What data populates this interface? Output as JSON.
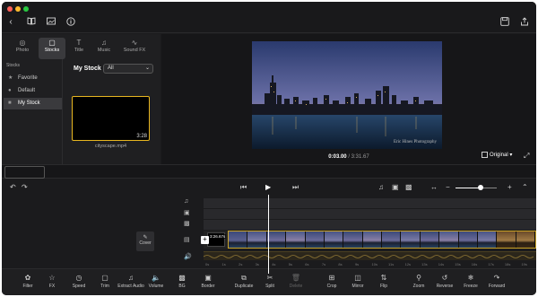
{
  "window": {
    "traffic_lights": [
      "#ff5f57",
      "#febc2e",
      "#28c840"
    ]
  },
  "titlebar": {
    "left_icons": [
      "back-icon",
      "book-icon",
      "image-icon",
      "info-icon"
    ],
    "right_icons": [
      "save-icon",
      "export-icon"
    ]
  },
  "library": {
    "tabs": [
      {
        "label": "Photo",
        "icon": "photo-icon"
      },
      {
        "label": "Stocks",
        "icon": "stocks-icon"
      },
      {
        "label": "Title",
        "icon": "title-icon"
      },
      {
        "label": "Music",
        "icon": "music-icon"
      },
      {
        "label": "Sound FX",
        "icon": "soundfx-icon"
      }
    ],
    "sidebar_header": "Stocks",
    "sidebar_items": [
      {
        "label": "Favorite",
        "icon": "star-icon"
      },
      {
        "label": "Default",
        "icon": "circle-icon"
      },
      {
        "label": "My Stock",
        "icon": "folder-icon"
      }
    ],
    "section_title": "My Stock",
    "filter_value": "All",
    "clip_duration": "3:28",
    "clip_name": "cityscape.mp4"
  },
  "preview": {
    "watermark": "Eric Hines Photography",
    "current_time": "0:03.00",
    "total_time": "3:31.67",
    "quality": "Original"
  },
  "timeline": {
    "clip_label": "3:26.67s",
    "cover_label": "Cover",
    "ruler_marks": [
      "0s",
      "1s",
      "2s",
      "3s",
      "4s",
      "5s",
      "6s",
      "7s",
      "8s",
      "9s",
      "10s",
      "11s",
      "12s",
      "13s",
      "14s",
      "15s",
      "16s",
      "17s",
      "18s",
      "19s"
    ]
  },
  "toolbar": {
    "tools": [
      {
        "label": "Filter",
        "icon": "filter-icon"
      },
      {
        "label": "FX",
        "icon": "fx-icon"
      },
      {
        "label": "Speed",
        "icon": "speed-icon"
      },
      {
        "label": "Trim",
        "icon": "trim-icon"
      },
      {
        "label": "Extract Audio",
        "icon": "extract-audio-icon"
      },
      {
        "label": "Volume",
        "icon": "volume-icon"
      },
      {
        "label": "BG",
        "icon": "bg-icon"
      },
      {
        "label": "Border",
        "icon": "border-icon"
      },
      {
        "label": "Duplicate",
        "icon": "duplicate-icon"
      },
      {
        "label": "Split",
        "icon": "split-icon"
      },
      {
        "label": "Delete",
        "icon": "delete-icon"
      },
      {
        "label": "Crop",
        "icon": "crop-icon"
      },
      {
        "label": "Mirror",
        "icon": "mirror-icon"
      },
      {
        "label": "Flip",
        "icon": "flip-icon"
      },
      {
        "label": "Zoom",
        "icon": "zoom-icon"
      },
      {
        "label": "Reverse",
        "icon": "reverse-icon"
      },
      {
        "label": "Freeze",
        "icon": "freeze-icon"
      },
      {
        "label": "Forward",
        "icon": "forward-icon"
      }
    ]
  }
}
